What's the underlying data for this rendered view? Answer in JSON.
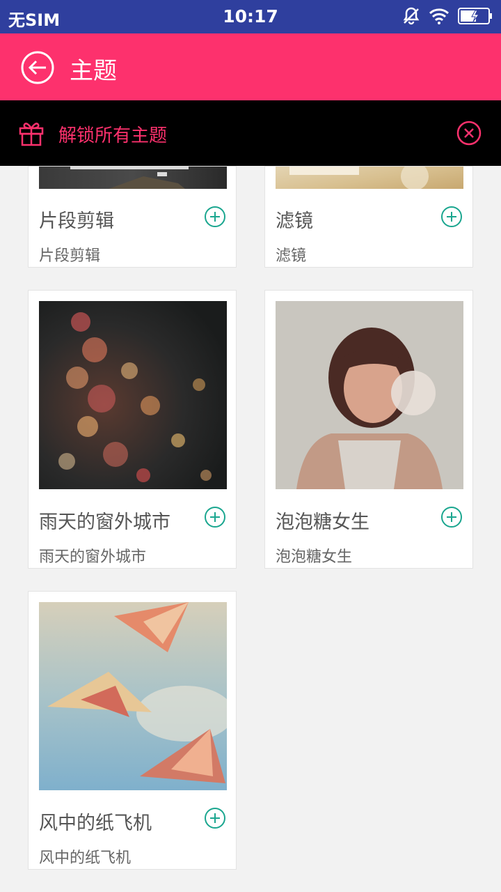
{
  "status_bar": {
    "carrier": "无SIM",
    "time": "10:17"
  },
  "app_bar": {
    "title": "主题",
    "back_icon": "back-arrow-circle-icon"
  },
  "banner": {
    "label": "解锁所有主题",
    "accent": "#fd316d"
  },
  "themes": [
    {
      "name": "片段剪辑",
      "subtitle": "片段剪辑"
    },
    {
      "name": "滤镜",
      "subtitle": "滤镜"
    },
    {
      "name": "雨天的窗外城市",
      "subtitle": "雨天的窗外城市"
    },
    {
      "name": "泡泡糖女生",
      "subtitle": "泡泡糖女生"
    },
    {
      "name": "风中的纸飞机",
      "subtitle": "风中的纸飞机"
    }
  ],
  "colors": {
    "status_bar": "#2f3f9e",
    "app_bar": "#fd316d",
    "add_icon": "#1aa68f"
  }
}
